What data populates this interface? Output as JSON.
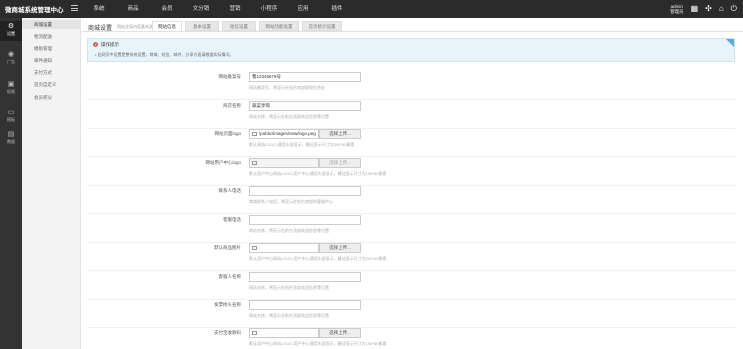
{
  "app": {
    "brand": "微商城系统管理中心"
  },
  "topnav": [
    "系统",
    "商品",
    "会员",
    "文分销",
    "营销",
    "小程序",
    "应用",
    "插件"
  ],
  "user": {
    "name": "admin",
    "role": "管理员"
  },
  "sidebar": [
    {
      "icon": "gear-icon",
      "glyph": "⚙",
      "label": "设置",
      "active": true
    },
    {
      "icon": "wifi-icon",
      "glyph": "◉",
      "label": "广告"
    },
    {
      "icon": "folder-icon",
      "glyph": "▣",
      "label": "权限"
    },
    {
      "icon": "monitor-icon",
      "glyph": "▭",
      "label": "模板"
    },
    {
      "icon": "lock-icon",
      "glyph": "▤",
      "label": "数据"
    }
  ],
  "submenu": [
    "商城设置",
    "物流配送",
    "模板管理",
    "邮件通知",
    "支付方式",
    "首页自定义",
    "会员积分"
  ],
  "main": {
    "title": "商城设置",
    "subtitle": "网站全局内容基本选项设置",
    "tabs": [
      "网站信息",
      "基本设置",
      "短信设置",
      "网站功能设置",
      "首页统计设置"
    ]
  },
  "notice": {
    "title": "操作提示",
    "text": "• 此网页中设置是整系统设置，商城、短信、邮件、分享方面请根据实际情况。"
  },
  "form": [
    {
      "label": "网站备案号",
      "value": "鲁12345678号",
      "hint": "网站备案号，将显示在前台底部版权信息处"
    },
    {
      "label": "商店名称",
      "value": "蔬菜享购",
      "hint": "网站名称，将显示在前台顶部欢迎信息等位置"
    },
    {
      "label": "网站页面logo",
      "value": "/public/images/new/logo.png",
      "button": "选择上传...",
      "hint": "默认网站LOGO,通用头部显示，最佳显示尺寸为240*60像素"
    },
    {
      "label": "网站用户中心logo",
      "value": "",
      "button": "选择上传...",
      "hint": "默认用户中心网站LOGO,用户中心通用头部显示，最佳显示尺寸为150*60像素"
    },
    {
      "label": "联系人电话",
      "value": "",
      "hint": "商城联系人电话，将显示在前台底部的客服中心"
    },
    {
      "label": "客服电话",
      "value": "",
      "hint": "网站名称，将显示在前台顶部欢迎信息等位置"
    },
    {
      "label": "默认商品图片",
      "value": "",
      "button": "选择上传...",
      "hint": "默认用户中心网站LOGO,用户中心通用头部显示，最佳显示尺寸为240*60像素"
    },
    {
      "label": "客服人名称",
      "value": "",
      "hint": "网站名称，将显示在前台顶部欢迎信息等位置"
    },
    {
      "label": "发票抬头名称",
      "value": "",
      "hint": "网站名称，将显示在前台顶部欢迎信息等位置"
    },
    {
      "label": "支付宝收款码",
      "value": "",
      "button": "选择上传...",
      "hint": "默认用户中心网站LOGO,用户中心通用头部显示，最佳显示尺寸为150*60像素"
    }
  ]
}
